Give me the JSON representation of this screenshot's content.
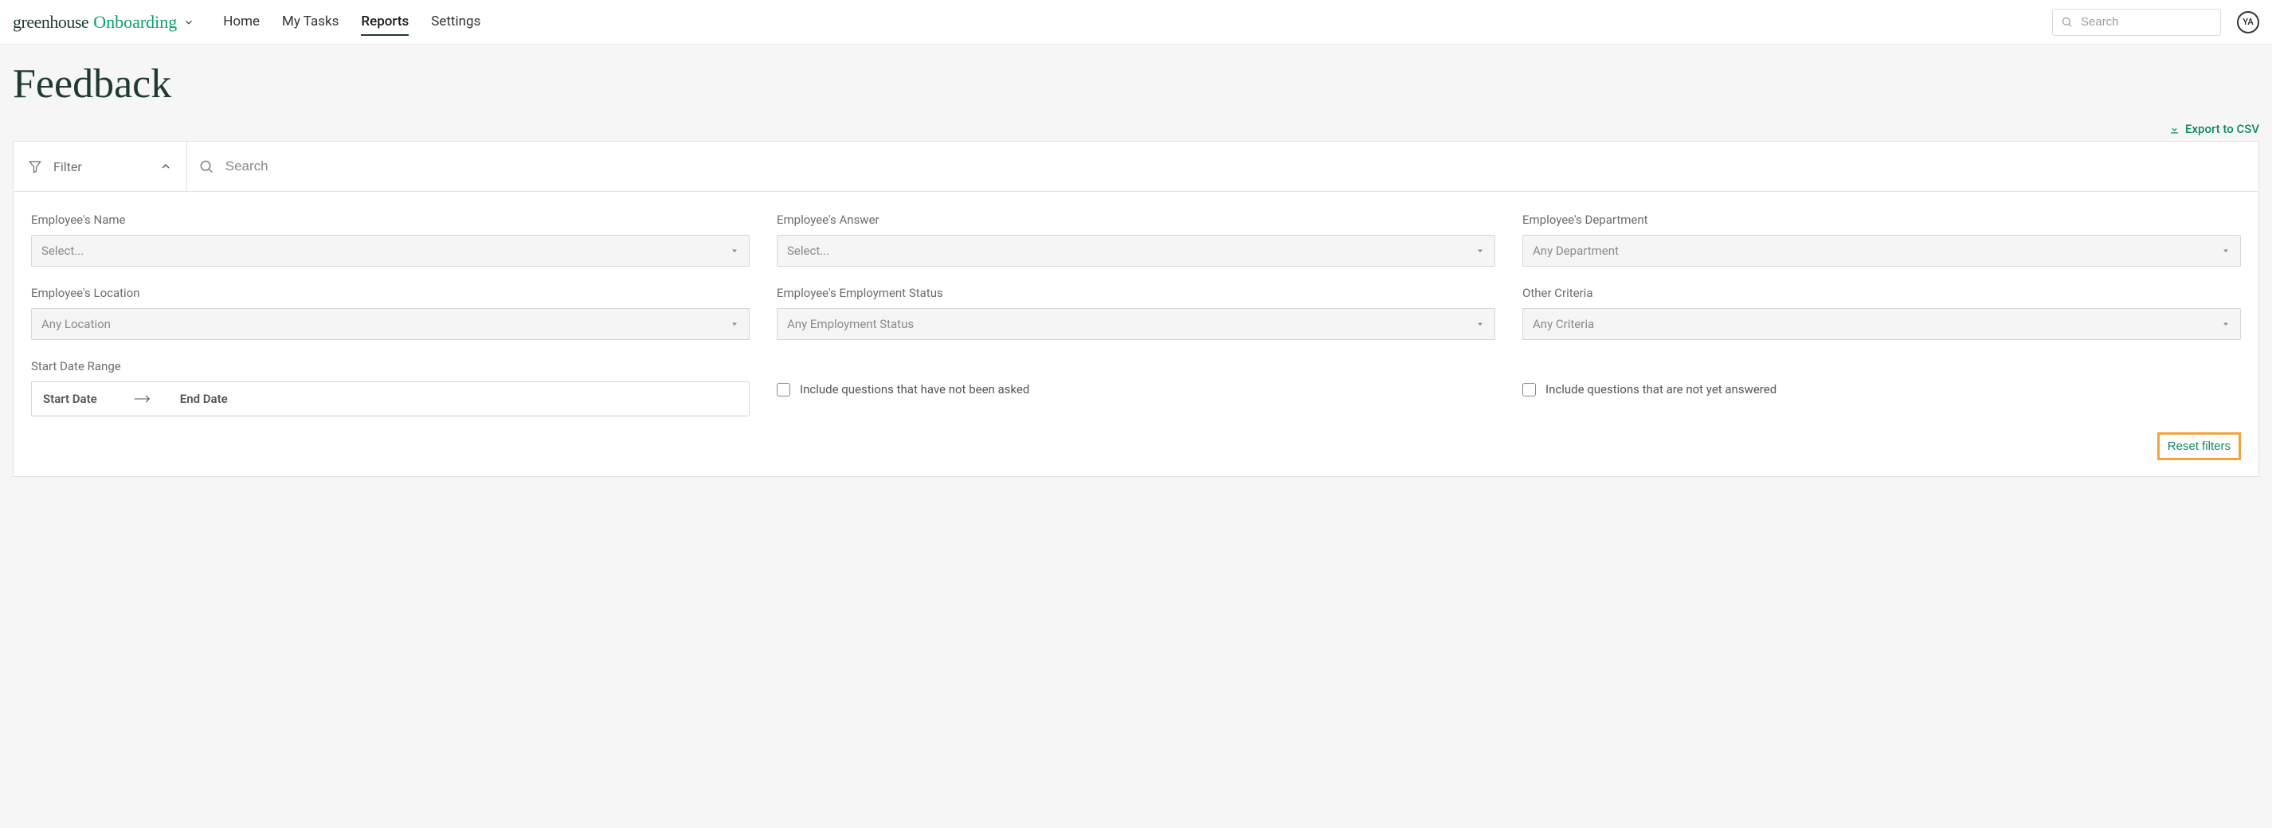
{
  "brand": {
    "name1": "greenhouse",
    "name2": "Onboarding"
  },
  "nav": {
    "home": "Home",
    "my_tasks": "My Tasks",
    "reports": "Reports",
    "settings": "Settings"
  },
  "top_search": {
    "placeholder": "Search"
  },
  "avatar": {
    "initials": "YA"
  },
  "page": {
    "title": "Feedback"
  },
  "export": {
    "label": "Export to CSV"
  },
  "filter_tab": {
    "label": "Filter"
  },
  "panel_search": {
    "placeholder": "Search"
  },
  "filters": {
    "employee_name": {
      "label": "Employee's Name",
      "placeholder": "Select..."
    },
    "employee_answer": {
      "label": "Employee's Answer",
      "placeholder": "Select..."
    },
    "employee_department": {
      "label": "Employee's Department",
      "placeholder": "Any Department"
    },
    "employee_location": {
      "label": "Employee's Location",
      "placeholder": "Any Location"
    },
    "employment_status": {
      "label": "Employee's Employment Status",
      "placeholder": "Any Employment Status"
    },
    "other_criteria": {
      "label": "Other Criteria",
      "placeholder": "Any Criteria"
    },
    "start_date_range": {
      "label": "Start Date Range",
      "start": "Start Date",
      "end": "End Date"
    },
    "include_not_asked": {
      "label": "Include questions that have not been asked"
    },
    "include_not_answered": {
      "label": "Include questions that are not yet answered"
    }
  },
  "reset": {
    "label": "Reset filters"
  }
}
